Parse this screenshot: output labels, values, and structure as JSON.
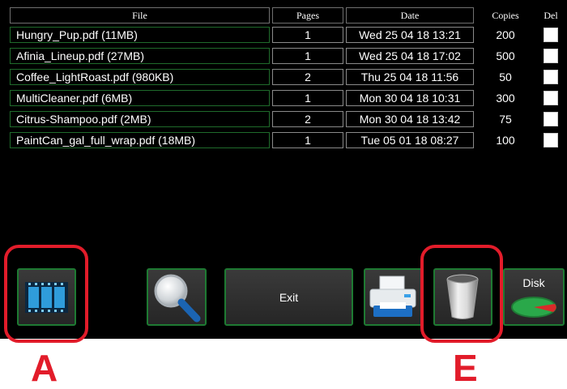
{
  "table": {
    "headers": {
      "file": "File",
      "pages": "Pages",
      "date": "Date",
      "copies": "Copies",
      "del": "Del"
    },
    "rows": [
      {
        "file": "Hungry_Pup.pdf  (11MB)",
        "pages": "1",
        "date": "Wed 25 04 18  13:21",
        "copies": "200"
      },
      {
        "file": "Afinia_Lineup.pdf  (27MB)",
        "pages": "1",
        "date": "Wed 25 04 18  17:02",
        "copies": "500"
      },
      {
        "file": "Coffee_LightRoast.pdf  (980KB)",
        "pages": "2",
        "date": "Thu 25 04 18  11:56",
        "copies": "50"
      },
      {
        "file": "MultiCleaner.pdf  (6MB)",
        "pages": "1",
        "date": "Mon 30 04 18  10:31",
        "copies": "300"
      },
      {
        "file": "Citrus-Shampoo.pdf  (2MB)",
        "pages": "2",
        "date": "Mon 30 04 18  13:42",
        "copies": "75"
      },
      {
        "file": "PaintCan_gal_full_wrap.pdf  (18MB)",
        "pages": "1",
        "date": "Tue 05 01 18  08:27",
        "copies": "100"
      }
    ]
  },
  "toolbar": {
    "exit_label": "Exit",
    "disk_label": "Disk"
  },
  "callouts": {
    "a_label": "A",
    "e_label": "E"
  },
  "colors": {
    "background": "#000000",
    "button_border": "#1e7a32",
    "callout": "#e21c2a"
  },
  "icons": [
    "film-icon",
    "magnifier-icon",
    "printer-icon",
    "trash-icon",
    "disk-gauge-icon"
  ]
}
